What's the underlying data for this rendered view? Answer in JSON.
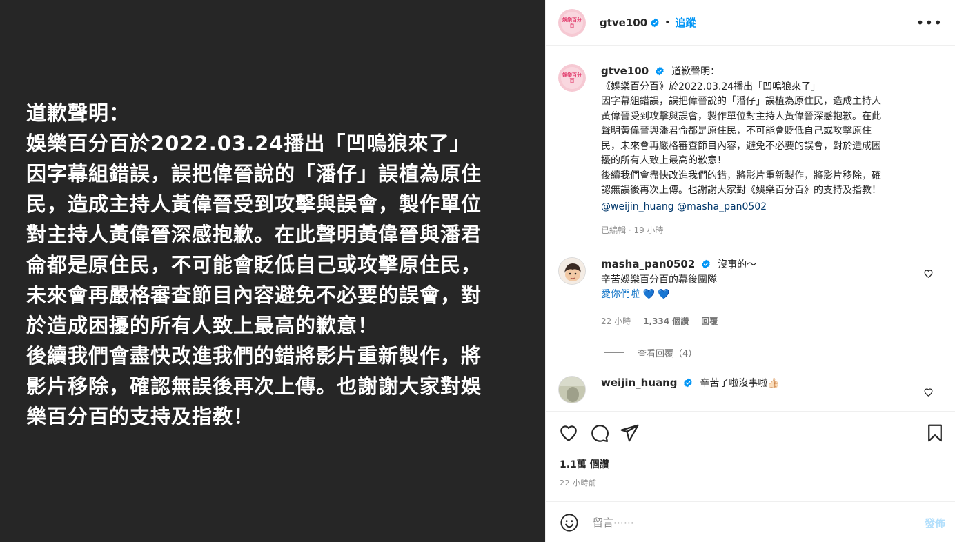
{
  "media": {
    "lines": [
      "道歉聲明：",
      "娛樂百分百於2022.03.24播出「凹嗚狼來了」",
      "因字幕組錯誤，誤把偉晉說的「潘仔」誤植為原住",
      "民，造成主持人黃偉晉受到攻擊與誤會，製作單位",
      "對主持人黃偉晉深感抱歉。在此聲明黃偉晉與潘君",
      "侖都是原住民，不可能會貶低自己或攻擊原住民，",
      "未來會再嚴格審查節目內容避免不必要的誤會，對",
      "於造成困擾的所有人致上最高的歉意！",
      "後續我們會盡快改進我們的錯將影片重新製作，將",
      "影片移除，確認無誤後再次上傳。也謝謝大家對娛",
      "樂百分百的支持及指教！"
    ]
  },
  "header": {
    "username": "gtve100",
    "avatar_text": "娛樂百分百",
    "dot": "•",
    "follow_label": "追蹤",
    "more_label": "•••"
  },
  "caption": {
    "username": "gtve100",
    "lines": [
      "道歉聲明：",
      "《娛樂百分百》於2022.03.24播出「凹嗚狼來了」",
      "因字幕組錯誤，誤把偉晉說的「潘仔」誤植為原住民，造成主持人",
      "黃偉晉受到攻擊與誤會，製作單位對主持人黃偉晉深感抱歉。在此",
      "聲明黃偉晉與潘君侖都是原住民，不可能會貶低自己或攻擊原住",
      "民，未來會再嚴格審查節目內容，避免不必要的誤會，對於造成困",
      "擾的所有人致上最高的歉意！",
      "後續我們會盡快改進我們的錯，將影片重新製作，將影片移除，確",
      "認無誤後再次上傳。也謝謝大家對《娛樂百分百》的支持及指教！"
    ],
    "mentions": "@weijin_huang @masha_pan0502",
    "meta": "已編輯 · 19 小時"
  },
  "comments": [
    {
      "username": "masha_pan0502",
      "lines": [
        "沒事的～",
        "辛苦娛樂百分百的幕後團隊",
        "愛你們啦 💙 💙"
      ],
      "time": "22 小時",
      "likes": "1,334 個讚",
      "reply_label": "回覆"
    },
    {
      "username": "weijin_huang",
      "lines": [
        "辛苦了啦沒事啦👍🏻"
      ]
    }
  ],
  "view_replies_label": "查看回覆（4）",
  "stats": {
    "views": "1.1萬 個讚",
    "time": "22 小時前"
  },
  "compose": {
    "placeholder": "留言⋯⋯",
    "post_label": "發佈"
  },
  "colors": {
    "accent": "#0095f6",
    "verified": "#0095f6",
    "media_bg": "#262626",
    "post_disabled": "#b2dffc"
  }
}
